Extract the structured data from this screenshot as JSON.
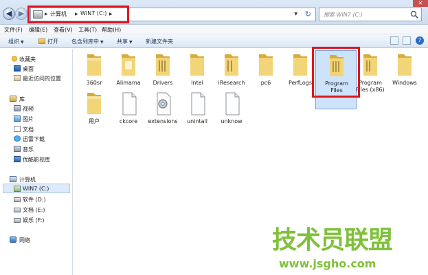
{
  "address_bar": {
    "crumbs": [
      "计算机",
      "WIN7 (C:)"
    ],
    "search_placeholder": "搜索 WIN7 (C:)"
  },
  "menu": [
    "文件(F)",
    "编辑(E)",
    "查看(V)",
    "工具(T)",
    "帮助(H)"
  ],
  "toolbar": {
    "organize": "组织",
    "open": "打开",
    "include_in_library": "包含到库中",
    "share": "共享",
    "new_folder": "新建文件夹"
  },
  "sidebar": {
    "favorites": "收藏夹",
    "desktop": "桌面",
    "recent": "最近访问的位置",
    "libraries": "库",
    "videos": "视频",
    "pictures": "图片",
    "documents": "文档",
    "xunlei": "迅雷下载",
    "music": "音乐",
    "youku": "优酷影视库",
    "computer": "计算机",
    "drive_c": "WIN7 (C:)",
    "drive_d": "软件 (D:)",
    "drive_e": "文档 (E:)",
    "drive_f": "娱乐 (F:)",
    "network": "网络"
  },
  "files": {
    "f1": "360sr",
    "f2": "Alimama",
    "f3": "Drivers",
    "f4": "Intel",
    "f5": "iResearch",
    "f6": "pc6",
    "f7": "PerfLogs",
    "f8_line1": "Program",
    "f8_line2": "Files",
    "f9_line1": "Program",
    "f9_line2": "Files (x86)",
    "f10": "Windows",
    "f11": "用户",
    "f12": "ckcore",
    "f13": "extensions",
    "f14": "unintall",
    "f15": "unknow"
  },
  "watermark": {
    "title": "技术员联盟",
    "url": "www.jsgho.com"
  },
  "colors": {
    "highlight": "#e0161f",
    "folder": "#e9c45b",
    "watermark": "#7fc13a"
  }
}
